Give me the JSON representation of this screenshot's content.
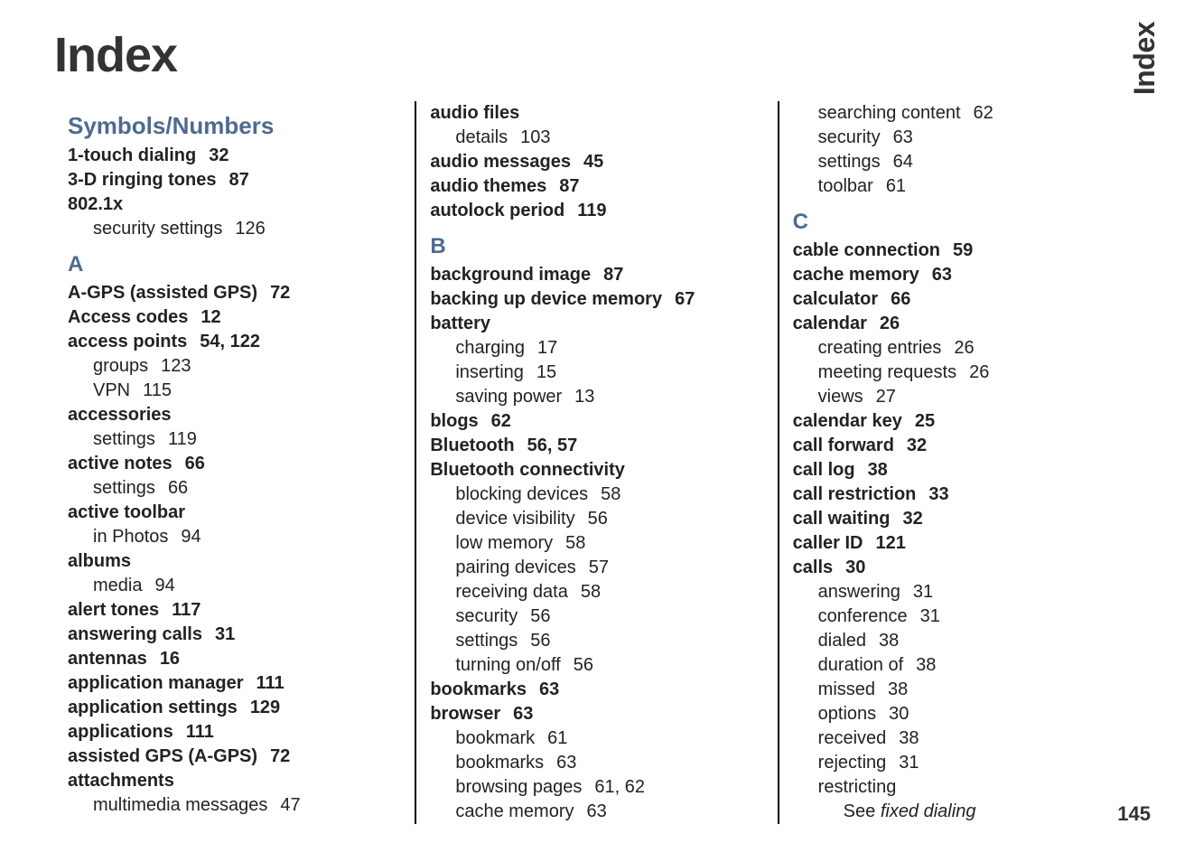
{
  "title": "Index",
  "side_tab": "Index",
  "page_number": "145",
  "columns": [
    {
      "blocks": [
        {
          "type": "group-head",
          "text": "Symbols/Numbers"
        },
        {
          "type": "entry",
          "term": "1-touch dialing",
          "pages": "32"
        },
        {
          "type": "entry",
          "term": "3-D ringing tones",
          "pages": "87"
        },
        {
          "type": "entry",
          "term": "802.1x",
          "pages": ""
        },
        {
          "type": "sub",
          "term": "security settings",
          "pages": "126"
        },
        {
          "type": "letter-head",
          "text": "A"
        },
        {
          "type": "entry",
          "term": "A-GPS (assisted GPS)",
          "pages": "72"
        },
        {
          "type": "entry",
          "term": "Access codes",
          "pages": "12"
        },
        {
          "type": "entry",
          "term": "access points",
          "pages": "54, 122"
        },
        {
          "type": "sub",
          "term": "groups",
          "pages": "123"
        },
        {
          "type": "sub",
          "term": "VPN",
          "pages": "115"
        },
        {
          "type": "entry",
          "term": "accessories",
          "pages": ""
        },
        {
          "type": "sub",
          "term": "settings",
          "pages": "119"
        },
        {
          "type": "entry",
          "term": "active notes",
          "pages": "66"
        },
        {
          "type": "sub",
          "term": "settings",
          "pages": "66"
        },
        {
          "type": "entry",
          "term": "active toolbar",
          "pages": ""
        },
        {
          "type": "sub",
          "term": "in Photos",
          "pages": "94"
        },
        {
          "type": "entry",
          "term": "albums",
          "pages": ""
        },
        {
          "type": "sub",
          "term": "media",
          "pages": "94"
        },
        {
          "type": "entry",
          "term": "alert tones",
          "pages": "117"
        },
        {
          "type": "entry",
          "term": "answering calls",
          "pages": "31"
        },
        {
          "type": "entry",
          "term": "antennas",
          "pages": "16"
        },
        {
          "type": "entry",
          "term": "application manager",
          "pages": "111"
        },
        {
          "type": "entry",
          "term": "application settings",
          "pages": "129"
        },
        {
          "type": "entry",
          "term": "applications",
          "pages": "111"
        },
        {
          "type": "entry",
          "term": "assisted GPS (A-GPS)",
          "pages": "72"
        },
        {
          "type": "entry",
          "term": "attachments",
          "pages": ""
        },
        {
          "type": "sub",
          "term": "multimedia messages",
          "pages": "47"
        }
      ]
    },
    {
      "blocks": [
        {
          "type": "entry",
          "term": "audio files",
          "pages": ""
        },
        {
          "type": "sub",
          "term": "details",
          "pages": "103"
        },
        {
          "type": "entry",
          "term": "audio messages",
          "pages": "45"
        },
        {
          "type": "entry",
          "term": "audio themes",
          "pages": "87"
        },
        {
          "type": "entry",
          "term": "autolock period",
          "pages": "119"
        },
        {
          "type": "letter-head",
          "text": "B"
        },
        {
          "type": "entry",
          "term": "background image",
          "pages": "87"
        },
        {
          "type": "entry",
          "term": "backing up device memory",
          "pages": "67"
        },
        {
          "type": "entry",
          "term": "battery",
          "pages": ""
        },
        {
          "type": "sub",
          "term": "charging",
          "pages": "17"
        },
        {
          "type": "sub",
          "term": "inserting",
          "pages": "15"
        },
        {
          "type": "sub",
          "term": "saving power",
          "pages": "13"
        },
        {
          "type": "entry",
          "term": "blogs",
          "pages": "62"
        },
        {
          "type": "entry",
          "term": "Bluetooth",
          "pages": "56, 57"
        },
        {
          "type": "entry",
          "term": "Bluetooth connectivity",
          "pages": ""
        },
        {
          "type": "sub",
          "term": "blocking devices",
          "pages": "58"
        },
        {
          "type": "sub",
          "term": "device visibility",
          "pages": "56"
        },
        {
          "type": "sub",
          "term": "low memory",
          "pages": "58"
        },
        {
          "type": "sub",
          "term": "pairing devices",
          "pages": "57"
        },
        {
          "type": "sub",
          "term": "receiving data",
          "pages": "58"
        },
        {
          "type": "sub",
          "term": "security",
          "pages": "56"
        },
        {
          "type": "sub",
          "term": "settings",
          "pages": "56"
        },
        {
          "type": "sub",
          "term": "turning on/off",
          "pages": "56"
        },
        {
          "type": "entry",
          "term": "bookmarks",
          "pages": "63"
        },
        {
          "type": "entry",
          "term": "browser",
          "pages": "63"
        },
        {
          "type": "sub",
          "term": "bookmark",
          "pages": "61"
        },
        {
          "type": "sub",
          "term": "bookmarks",
          "pages": "63"
        },
        {
          "type": "sub",
          "term": "browsing pages",
          "pages": "61, 62"
        },
        {
          "type": "sub",
          "term": "cache memory",
          "pages": "63"
        }
      ]
    },
    {
      "blocks": [
        {
          "type": "sub",
          "term": "searching content",
          "pages": "62"
        },
        {
          "type": "sub",
          "term": "security",
          "pages": "63"
        },
        {
          "type": "sub",
          "term": "settings",
          "pages": "64"
        },
        {
          "type": "sub",
          "term": "toolbar",
          "pages": "61"
        },
        {
          "type": "letter-head",
          "text": "C"
        },
        {
          "type": "entry",
          "term": "cable connection",
          "pages": "59"
        },
        {
          "type": "entry",
          "term": "cache memory",
          "pages": "63"
        },
        {
          "type": "entry",
          "term": "calculator",
          "pages": "66"
        },
        {
          "type": "entry",
          "term": "calendar",
          "pages": "26"
        },
        {
          "type": "sub",
          "term": "creating entries",
          "pages": "26"
        },
        {
          "type": "sub",
          "term": "meeting requests",
          "pages": "26"
        },
        {
          "type": "sub",
          "term": "views",
          "pages": "27"
        },
        {
          "type": "entry",
          "term": "calendar key",
          "pages": "25"
        },
        {
          "type": "entry",
          "term": "call forward",
          "pages": "32"
        },
        {
          "type": "entry",
          "term": "call log",
          "pages": "38"
        },
        {
          "type": "entry",
          "term": "call restriction",
          "pages": "33"
        },
        {
          "type": "entry",
          "term": "call waiting",
          "pages": "32"
        },
        {
          "type": "entry",
          "term": "caller ID",
          "pages": "121"
        },
        {
          "type": "entry",
          "term": "calls",
          "pages": "30"
        },
        {
          "type": "sub",
          "term": "answering",
          "pages": "31"
        },
        {
          "type": "sub",
          "term": "conference",
          "pages": "31"
        },
        {
          "type": "sub",
          "term": "dialed",
          "pages": "38"
        },
        {
          "type": "sub",
          "term": "duration of",
          "pages": "38"
        },
        {
          "type": "sub",
          "term": "missed",
          "pages": "38"
        },
        {
          "type": "sub",
          "term": "options",
          "pages": "30"
        },
        {
          "type": "sub",
          "term": "received",
          "pages": "38"
        },
        {
          "type": "sub",
          "term": "rejecting",
          "pages": "31"
        },
        {
          "type": "sub",
          "term": "restricting",
          "pages": ""
        },
        {
          "type": "see",
          "see": "See ",
          "target": "fixed dialing"
        }
      ]
    }
  ]
}
